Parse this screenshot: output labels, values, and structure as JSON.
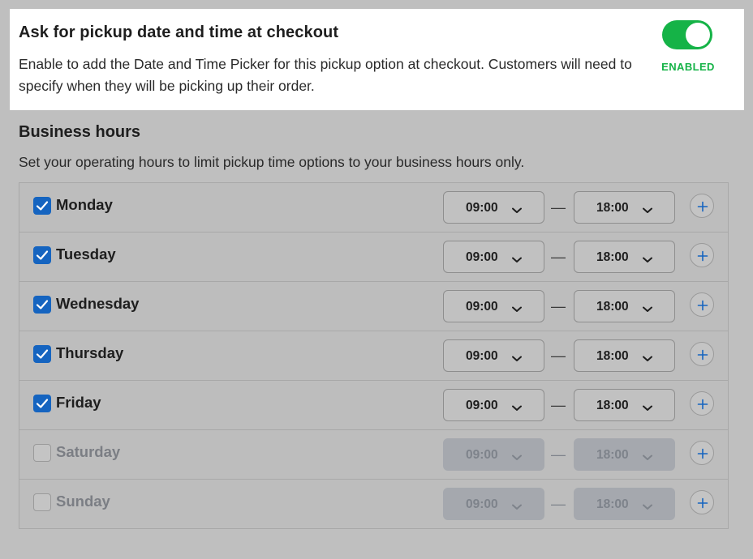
{
  "pickup_option": {
    "title": "Ask for pickup date and time at checkout",
    "description": "Enable to add the Date and Time Picker for this pickup option at checkout. Customers will need to specify when they will be picking up their order.",
    "toggle_state": "on",
    "status_label": "ENABLED",
    "accent_color": "#15b347"
  },
  "business_hours": {
    "title": "Business hours",
    "description": "Set your operating hours to limit pickup time options to your business hours only.",
    "separator": "—",
    "checkbox_color": "#1564c0",
    "days": [
      {
        "name": "Monday",
        "checked": true,
        "start": "09:00",
        "end": "18:00"
      },
      {
        "name": "Tuesday",
        "checked": true,
        "start": "09:00",
        "end": "18:00"
      },
      {
        "name": "Wednesday",
        "checked": true,
        "start": "09:00",
        "end": "18:00"
      },
      {
        "name": "Thursday",
        "checked": true,
        "start": "09:00",
        "end": "18:00"
      },
      {
        "name": "Friday",
        "checked": true,
        "start": "09:00",
        "end": "18:00"
      },
      {
        "name": "Saturday",
        "checked": false,
        "start": "09:00",
        "end": "18:00"
      },
      {
        "name": "Sunday",
        "checked": false,
        "start": "09:00",
        "end": "18:00"
      }
    ]
  }
}
